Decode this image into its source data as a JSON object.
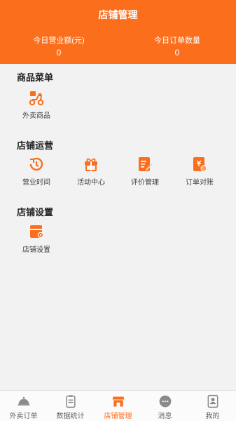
{
  "header": {
    "title": "店铺管理",
    "stats": [
      {
        "label": "今日营业额(元)",
        "value": "0"
      },
      {
        "label": "今日订单数量",
        "value": "0"
      }
    ]
  },
  "sections": [
    {
      "title": "商品菜单",
      "items": [
        {
          "label": "外卖商品",
          "icon": "delivery-scooter-icon"
        }
      ]
    },
    {
      "title": "店铺运营",
      "items": [
        {
          "label": "营业时间",
          "icon": "clock-icon"
        },
        {
          "label": "活动中心",
          "icon": "gift-icon"
        },
        {
          "label": "评价管理",
          "icon": "review-edit-icon"
        },
        {
          "label": "订单对账",
          "icon": "order-reconcile-icon"
        }
      ]
    },
    {
      "title": "店铺设置",
      "items": [
        {
          "label": "店铺设置",
          "icon": "store-settings-icon"
        }
      ]
    }
  ],
  "tabbar": {
    "active": 2,
    "items": [
      {
        "label": "外卖订单",
        "icon": "cloche-icon"
      },
      {
        "label": "数据统计",
        "icon": "clipboard-icon"
      },
      {
        "label": "店铺管理",
        "icon": "storefront-icon"
      },
      {
        "label": "消息",
        "icon": "chat-bubble-icon"
      },
      {
        "label": "我的",
        "icon": "profile-icon"
      }
    ]
  },
  "colors": {
    "accent": "#fb6e1c",
    "background": "#f2f2f2"
  }
}
